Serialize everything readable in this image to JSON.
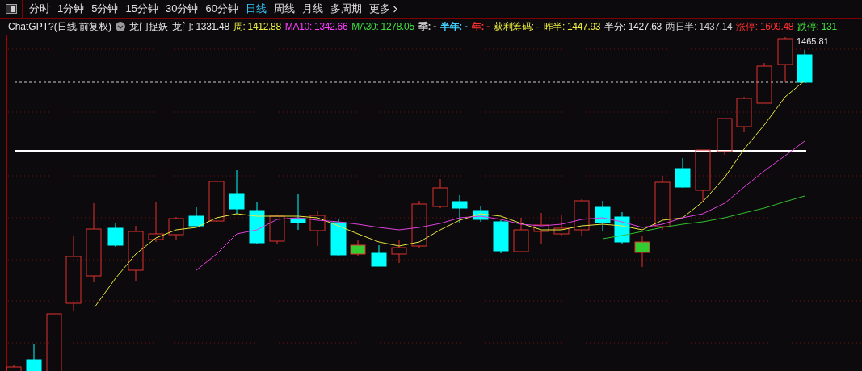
{
  "toolbar": {
    "tabs": [
      {
        "label": "分时",
        "selected": false
      },
      {
        "label": "1分钟",
        "selected": false
      },
      {
        "label": "5分钟",
        "selected": false
      },
      {
        "label": "15分钟",
        "selected": false
      },
      {
        "label": "30分钟",
        "selected": false
      },
      {
        "label": "60分钟",
        "selected": false
      },
      {
        "label": "日线",
        "selected": true
      },
      {
        "label": "周线",
        "selected": false
      },
      {
        "label": "月线",
        "selected": false
      },
      {
        "label": "多周期",
        "selected": false
      },
      {
        "label": "更多",
        "selected": false
      }
    ]
  },
  "info_bar": {
    "title": "ChatGPT?(日线,前复权)",
    "indicator_name": "龙门捉妖",
    "readings": [
      {
        "text": "龙门: 1331.48",
        "color": "#e6e6e6"
      },
      {
        "text": "周: 1412.88",
        "color": "#f0f040"
      },
      {
        "text": "MA10: 1342.66",
        "color": "#ff40ff"
      },
      {
        "text": "MA30: 1278.05",
        "color": "#40e040"
      },
      {
        "text": "季: -",
        "color": "#c8c8c8"
      },
      {
        "text": "半年: -",
        "color": "#40d0ff"
      },
      {
        "text": "年: -",
        "color": "#ff3030"
      },
      {
        "text": "获利筹码: -",
        "color": "#f0f040"
      },
      {
        "text": "昨半: 1447.93",
        "color": "#f0f040"
      },
      {
        "text": "半分: 1427.63",
        "color": "#e6e6e6"
      },
      {
        "text": "两日半: 1437.14",
        "color": "#c8c8c8"
      },
      {
        "text": "涨停: 1609.48",
        "color": "#ff3030"
      },
      {
        "text": "跌停: 131",
        "color": "#40e040"
      }
    ]
  },
  "chart": {
    "high_label": "1465.81"
  }
}
